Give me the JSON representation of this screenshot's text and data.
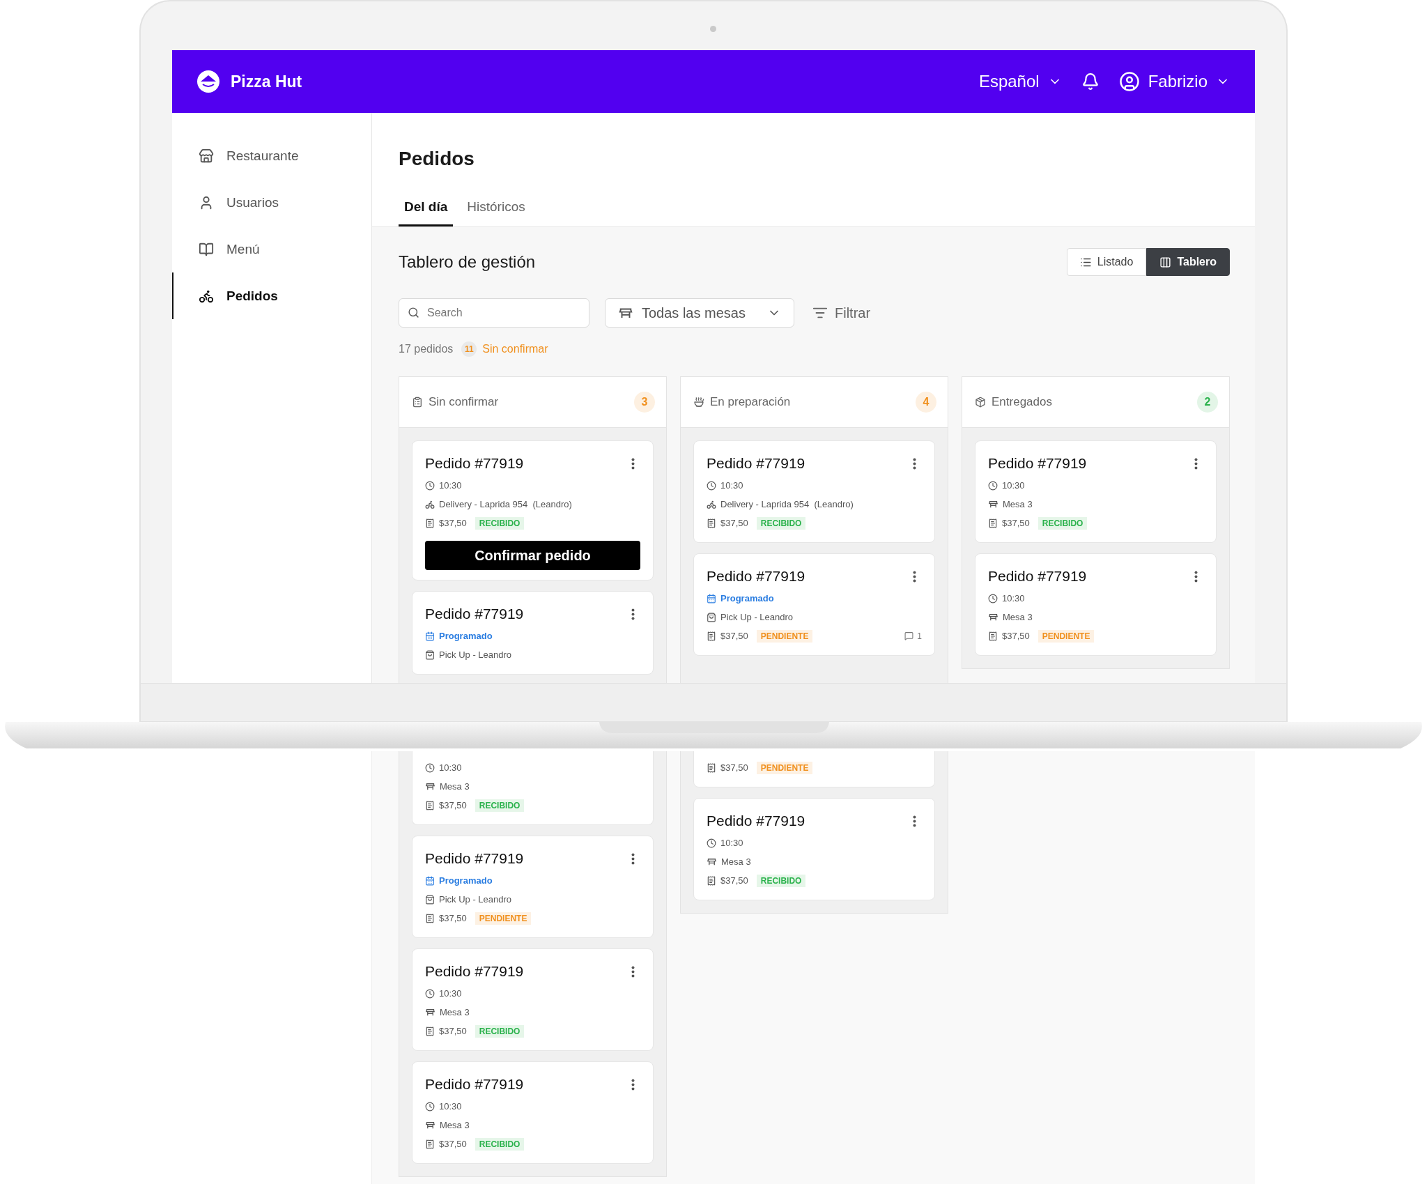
{
  "header": {
    "brand": "Pizza Hut",
    "language": "Español",
    "user": "Fabrizio"
  },
  "sidebar": {
    "items": [
      {
        "label": "Restaurante",
        "kind": "store",
        "selected": false
      },
      {
        "label": "Usuarios",
        "kind": "user",
        "selected": false
      },
      {
        "label": "Menú",
        "kind": "book",
        "selected": false
      },
      {
        "label": "Pedidos",
        "kind": "bike",
        "selected": true
      }
    ]
  },
  "page": {
    "title": "Pedidos",
    "tabs": [
      {
        "label": "Del día",
        "selected": true
      },
      {
        "label": "Históricos",
        "selected": false
      }
    ]
  },
  "board": {
    "title": "Tablero de gestión",
    "views": [
      {
        "label": "Listado",
        "kind": "list",
        "selected": false
      },
      {
        "label": "Tablero",
        "kind": "kanban",
        "selected": true
      }
    ],
    "search": {
      "placeholder": "Search"
    },
    "table_filter": "Todas las mesas",
    "filter_button": "Filtrar",
    "summary": {
      "total": "17 pedidos",
      "unconfirmed_count": "11",
      "unconfirmed_label": "Sin confirmar"
    },
    "columns": [
      {
        "title": "Sin confirmar",
        "kind": "unconfirmed",
        "count": "3",
        "color": "#f0901e",
        "cards": [
          {
            "kind": "full",
            "title": "Pedido #77919",
            "rows": [
              {
                "kind": "time",
                "text": "10:30"
              },
              {
                "kind": "delivery",
                "text": "Delivery - Laprida 954  (Leandro)"
              },
              {
                "kind": "price",
                "text": "$37,50",
                "status": {
                  "text": "RECIBIDO",
                  "kind": "received"
                }
              }
            ],
            "action": "Confirmar pedido"
          },
          {
            "kind": "full",
            "title": "Pedido #77919",
            "rows": [
              {
                "kind": "scheduled",
                "text": "Programado"
              },
              {
                "kind": "pickup",
                "text": "Pick Up - Leandro"
              }
            ]
          },
          {
            "kind": "cut_top",
            "rows": [
              {
                "kind": "time",
                "text": "10:30"
              },
              {
                "kind": "table",
                "text": "Mesa 3"
              },
              {
                "kind": "price",
                "text": "$37,50",
                "status": {
                  "text": "RECIBIDO",
                  "kind": "received"
                }
              }
            ]
          },
          {
            "kind": "full",
            "title": "Pedido #77919",
            "rows": [
              {
                "kind": "scheduled",
                "text": "Programado"
              },
              {
                "kind": "pickup",
                "text": "Pick Up - Leandro"
              },
              {
                "kind": "price",
                "text": "$37,50",
                "status": {
                  "text": "PENDIENTE",
                  "kind": "pending"
                }
              }
            ]
          },
          {
            "kind": "full",
            "title": "Pedido #77919",
            "rows": [
              {
                "kind": "time",
                "text": "10:30"
              },
              {
                "kind": "table",
                "text": "Mesa 3"
              },
              {
                "kind": "price",
                "text": "$37,50",
                "status": {
                  "text": "RECIBIDO",
                  "kind": "received"
                }
              }
            ]
          },
          {
            "kind": "full",
            "title": "Pedido #77919",
            "rows": [
              {
                "kind": "time",
                "text": "10:30"
              },
              {
                "kind": "table",
                "text": "Mesa 3"
              },
              {
                "kind": "price",
                "text": "$37,50",
                "status": {
                  "text": "RECIBIDO",
                  "kind": "received"
                }
              }
            ]
          }
        ]
      },
      {
        "title": "En preparación",
        "kind": "preparing",
        "count": "4",
        "color": "#f0901e",
        "cards": [
          {
            "kind": "full",
            "title": "Pedido #77919",
            "rows": [
              {
                "kind": "time",
                "text": "10:30"
              },
              {
                "kind": "delivery",
                "text": "Delivery - Laprida 954  (Leandro)"
              },
              {
                "kind": "price",
                "text": "$37,50",
                "status": {
                  "text": "RECIBIDO",
                  "kind": "received"
                }
              }
            ]
          },
          {
            "kind": "full",
            "title": "Pedido #77919",
            "rows": [
              {
                "kind": "scheduled",
                "text": "Programado"
              },
              {
                "kind": "pickup",
                "text": "Pick Up - Leandro"
              },
              {
                "kind": "price",
                "text": "$37,50",
                "status": {
                  "text": "PENDIENTE",
                  "kind": "pending"
                },
                "comments": "1"
              }
            ]
          },
          {
            "kind": "cut_top",
            "rows": [
              {
                "kind": "price",
                "text": "$37,50",
                "status": {
                  "text": "PENDIENTE",
                  "kind": "pending"
                }
              }
            ]
          },
          {
            "kind": "full",
            "title": "Pedido #77919",
            "rows": [
              {
                "kind": "time",
                "text": "10:30"
              },
              {
                "kind": "table",
                "text": "Mesa 3"
              },
              {
                "kind": "price",
                "text": "$37,50",
                "status": {
                  "text": "RECIBIDO",
                  "kind": "received"
                }
              }
            ]
          }
        ]
      },
      {
        "title": "Entregados",
        "kind": "delivered",
        "count": "2",
        "color": "#2bb24c",
        "cards": [
          {
            "kind": "full",
            "title": "Pedido #77919",
            "rows": [
              {
                "kind": "time",
                "text": "10:30"
              },
              {
                "kind": "table",
                "text": "Mesa 3"
              },
              {
                "kind": "price",
                "text": "$37,50",
                "status": {
                  "text": "RECIBIDO",
                  "kind": "received"
                }
              }
            ]
          },
          {
            "kind": "full",
            "title": "Pedido #77919",
            "rows": [
              {
                "kind": "time",
                "text": "10:30"
              },
              {
                "kind": "table",
                "text": "Mesa 3"
              },
              {
                "kind": "price",
                "text": "$37,50",
                "status": {
                  "text": "PENDIENTE",
                  "kind": "pending"
                }
              }
            ]
          }
        ]
      }
    ]
  }
}
